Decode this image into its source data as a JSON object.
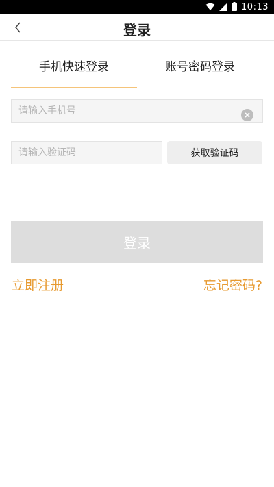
{
  "status_bar": {
    "time": "10:13"
  },
  "header": {
    "title": "登录"
  },
  "tabs": [
    {
      "label": "手机快速登录",
      "active": true
    },
    {
      "label": "账号密码登录",
      "active": false
    }
  ],
  "form": {
    "phone_placeholder": "请输入手机号",
    "code_placeholder": "请输入验证码",
    "get_code_label": "获取验证码",
    "login_label": "登录"
  },
  "links": {
    "register": "立即注册",
    "forgot": "忘记密码?"
  },
  "colors": {
    "accent": "#e79a30",
    "tab_underline": "#f5c47a",
    "disabled_button": "#dddddd"
  }
}
